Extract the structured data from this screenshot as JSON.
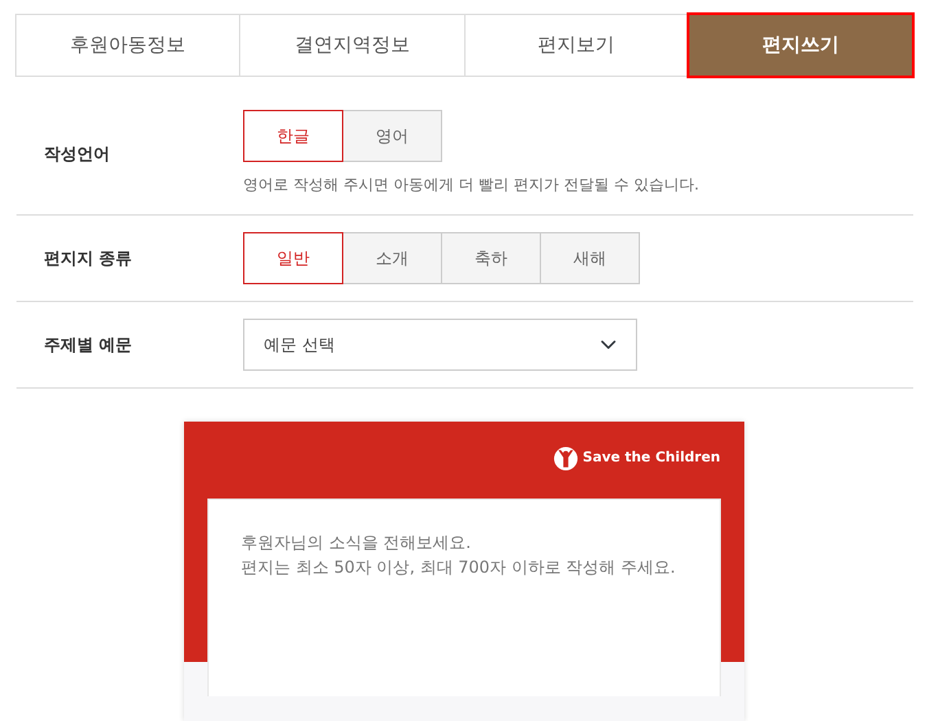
{
  "tabs": [
    {
      "label": "후원아동정보",
      "selected": false
    },
    {
      "label": "결연지역정보",
      "selected": false
    },
    {
      "label": "편지보기",
      "selected": false
    },
    {
      "label": "편지쓰기",
      "selected": true
    }
  ],
  "form": [
    {
      "kind": "options",
      "label": "작성언어",
      "options": [
        {
          "label": "한글",
          "selected": true
        },
        {
          "label": "영어",
          "selected": false
        }
      ],
      "hint": "영어로 작성해 주시면 아동에게 더 빨리 편지가 전달될 수 있습니다."
    },
    {
      "kind": "options",
      "label": "편지지 종류",
      "options": [
        {
          "label": "일반",
          "selected": true
        },
        {
          "label": "소개",
          "selected": false
        },
        {
          "label": "축하",
          "selected": false
        },
        {
          "label": "새해",
          "selected": false
        }
      ]
    },
    {
      "kind": "select",
      "label": "주제별 예문",
      "value": "예문 선택"
    }
  ],
  "letter": {
    "brand": "Save the Children",
    "placeholder": "후원자님의 소식을 전해보세요.\n편지는 최소 50자 이상, 최대 700자 이하로 작성해 주세요."
  }
}
